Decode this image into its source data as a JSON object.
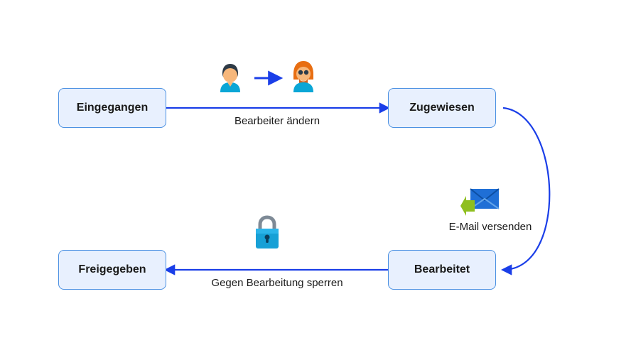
{
  "workflow": {
    "states": {
      "s1": "Eingegangen",
      "s2": "Zugewiesen",
      "s3": "Bearbeitet",
      "s4": "Freigegeben"
    },
    "transitions": {
      "t1": {
        "label": "Bearbeiter ändern",
        "icon": "assignee-change"
      },
      "t2": {
        "label": "E-Mail versenden",
        "icon": "email-send"
      },
      "t3": {
        "label": "Gegen Bearbeitung sperren",
        "icon": "lock"
      }
    }
  },
  "chart_data": {
    "type": "state-diagram",
    "title": "",
    "states": [
      "Eingegangen",
      "Zugewiesen",
      "Bearbeitet",
      "Freigegeben"
    ],
    "transitions": [
      {
        "from": "Eingegangen",
        "to": "Zugewiesen",
        "label": "Bearbeiter ändern",
        "icon": "assignee-change"
      },
      {
        "from": "Zugewiesen",
        "to": "Bearbeitet",
        "label": "E-Mail versenden",
        "icon": "email-send"
      },
      {
        "from": "Bearbeitet",
        "to": "Freigegeben",
        "label": "Gegen Bearbeitung sperren",
        "icon": "lock"
      }
    ],
    "colors": {
      "state_fill": "#e8f0fe",
      "state_border": "#4a90e2",
      "arrow": "#1a3ee8"
    }
  }
}
